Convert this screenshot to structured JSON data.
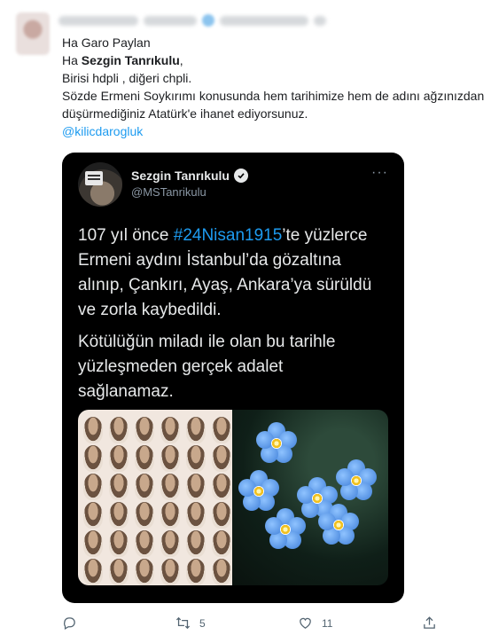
{
  "outer_tweet": {
    "line1": "Ha Garo Paylan",
    "line2_prefix": "Ha ",
    "line2_bold": "Sezgin Tanrıkulu",
    "line2_suffix": ",",
    "line3": "Birisi hdpli , diğeri chpli.",
    "line4": "Sözde Ermeni Soykırımı konusunda hem tarihimize hem de adını ağzınızdan",
    "line5": "düşürmediğiniz Atatürk'e ihanet ediyorsunuz.",
    "mention": "@kilicdarogluk"
  },
  "quoted_tweet": {
    "name": "Sezgin Tanrıkulu",
    "handle": "@MSTanrikulu",
    "more": "···",
    "body": {
      "p1_l1_prefix": "107 yıl önce ",
      "p1_l1_hashtag": "#24Nisan1915",
      "p1_l1_suffix": "’te yüzlerce",
      "p1_l2": "Ermeni aydını İstanbul’da gözaltına",
      "p1_l3": "alınıp, Çankırı, Ayaş, Ankara’ya sürüldü",
      "p1_l4": "ve zorla kaybedildi.",
      "p2_l1": "Kötülüğün miladı ile olan bu tarihle",
      "p2_l2": "yüzleşmeden gerçek adalet",
      "p2_l3": "sağlanamaz."
    }
  },
  "actions": {
    "reply": {
      "icon": "reply-icon",
      "count": ""
    },
    "retweet": {
      "icon": "retweet-icon",
      "count": "5"
    },
    "like": {
      "icon": "like-icon",
      "count": "11"
    },
    "share": {
      "icon": "share-icon",
      "count": ""
    }
  },
  "colors": {
    "link": "#1d9bf0",
    "card_bg": "#000000",
    "icon_gray": "#536471"
  }
}
